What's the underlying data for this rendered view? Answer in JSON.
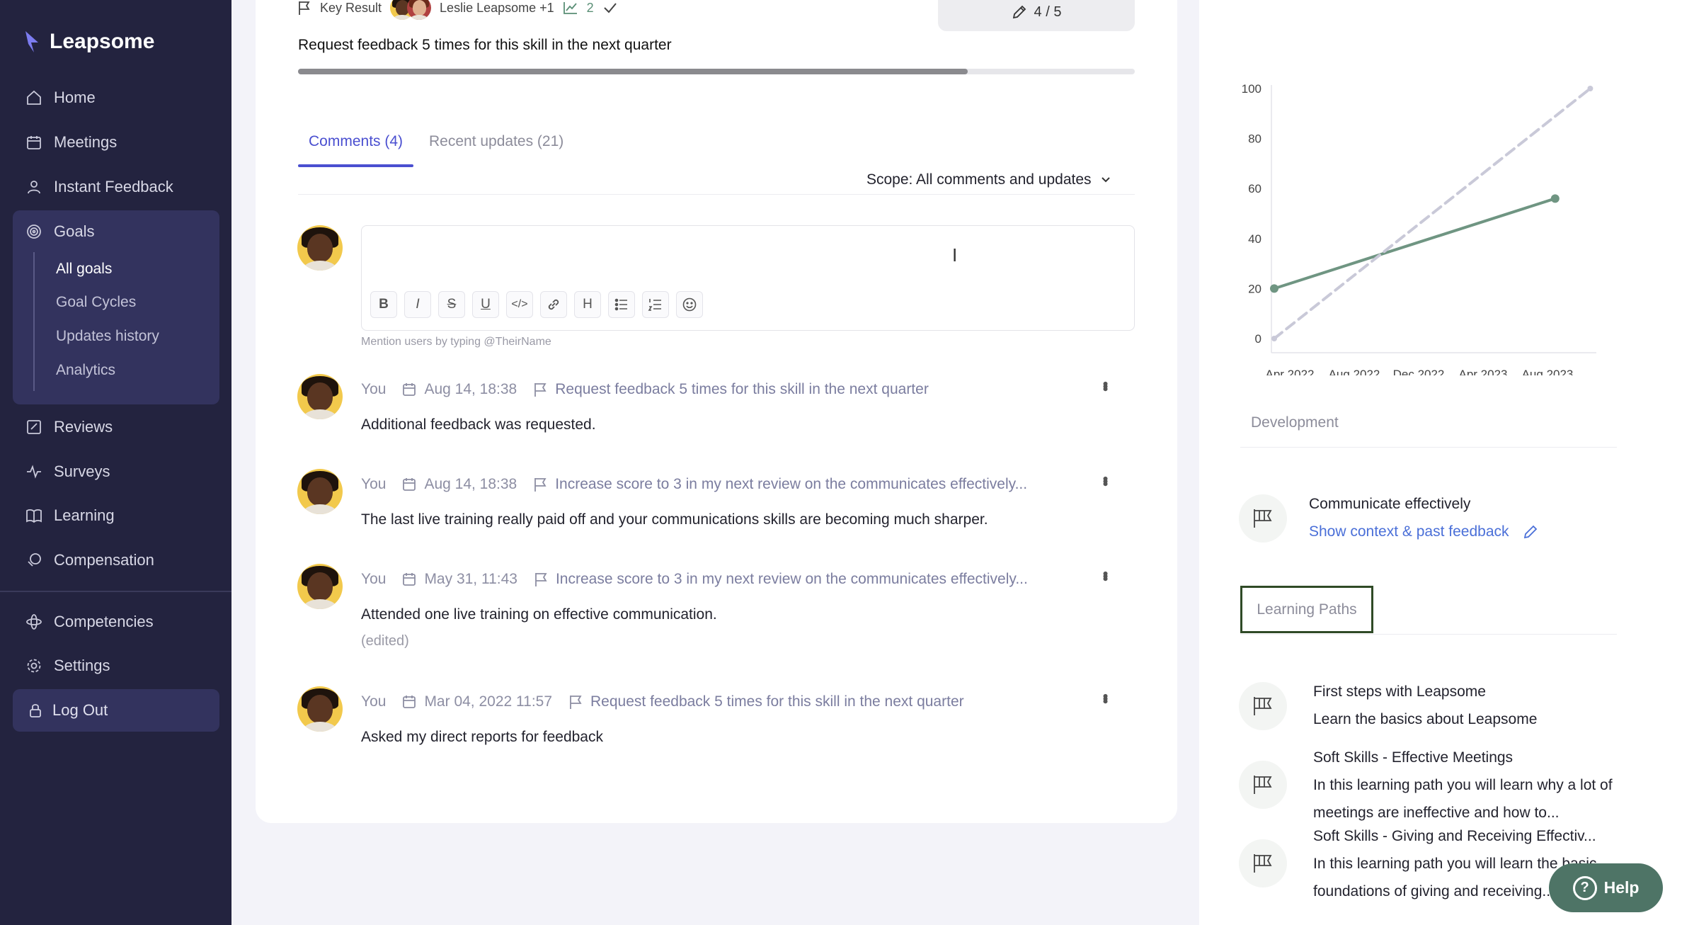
{
  "brand": {
    "name": "Leapsome"
  },
  "nav": {
    "home": "Home",
    "meetings": "Meetings",
    "instant_feedback": "Instant Feedback",
    "goals": "Goals",
    "goals_sub": [
      "All goals",
      "Goal Cycles",
      "Updates history",
      "Analytics"
    ],
    "reviews": "Reviews",
    "surveys": "Surveys",
    "learning": "Learning",
    "compensation": "Compensation",
    "competencies": "Competencies",
    "settings": "Settings",
    "logout": "Log Out"
  },
  "key_result": {
    "type_label": "Key Result",
    "owners": "Leslie Leapsome +1",
    "updates_count": "2",
    "score": "4 / 5",
    "title": "Request feedback 5 times for this skill in the next quarter",
    "progress": 0.8
  },
  "tabs": {
    "comments": "Comments (4)",
    "updates": "Recent updates (21)"
  },
  "scope": {
    "label": "Scope: All comments and updates"
  },
  "editor": {
    "mention_hint": "Mention users by typing @TheirName",
    "toolbar": [
      "B",
      "I",
      "S",
      "U",
      "</>",
      "link",
      "H",
      "bullet-list",
      "numbered-list",
      "emoji"
    ]
  },
  "comments": [
    {
      "author": "You",
      "date": "Aug 14, 18:38",
      "goal": "Request feedback 5 times for this skill in the next quarter",
      "text": "Additional feedback was requested.",
      "edited": ""
    },
    {
      "author": "You",
      "date": "Aug 14, 18:38",
      "goal": "Increase score to 3 in my next review on the communicates effectively...",
      "text": "The last live training really paid off and your communications skills are becoming much sharper.",
      "edited": ""
    },
    {
      "author": "You",
      "date": "May 31, 11:43",
      "goal": "Increase score to 3 in my next review on the communicates effectively...",
      "text": "Attended one live training on effective communication.",
      "edited": "(edited)"
    },
    {
      "author": "You",
      "date": "Mar 04, 2022 11:57",
      "goal": "Request feedback 5 times for this skill in the next quarter",
      "text": "Asked my direct reports for feedback",
      "edited": ""
    }
  ],
  "chart_data": {
    "type": "line",
    "x_ticks": [
      "Apr 2022",
      "Aug 2022",
      "Dec 2022",
      "Apr 2023",
      "Aug 2023"
    ],
    "y_ticks": [
      0,
      20,
      40,
      60,
      80,
      100
    ],
    "ylim": [
      0,
      100
    ],
    "series": [
      {
        "style": "solid",
        "color": "#6f9582",
        "points": [
          {
            "x": "2022-04",
            "y": 20
          },
          {
            "x": "2023-08",
            "y": 56
          }
        ]
      },
      {
        "style": "dashed",
        "color": "#c9c9d8",
        "points": [
          {
            "x": "2022-04",
            "y": 0
          },
          {
            "x": "2023-10",
            "y": 100
          }
        ]
      }
    ]
  },
  "development": {
    "label": "Development",
    "competency": "Communicate effectively",
    "link": "Show context & past feedback"
  },
  "learning_paths": {
    "label": "Learning Paths",
    "items": [
      {
        "title": "First steps with Leapsome",
        "desc": "Learn the basics about Leapsome"
      },
      {
        "title": "Soft Skills - Effective Meetings",
        "desc": "In this learning path you will learn why a lot of meetings are ineffective and how to..."
      },
      {
        "title": "Soft Skills - Giving and Receiving Effectiv...",
        "desc": "In this learning path you will learn the basic foundations of giving and receiving..."
      }
    ]
  },
  "help": {
    "label": "Help"
  }
}
